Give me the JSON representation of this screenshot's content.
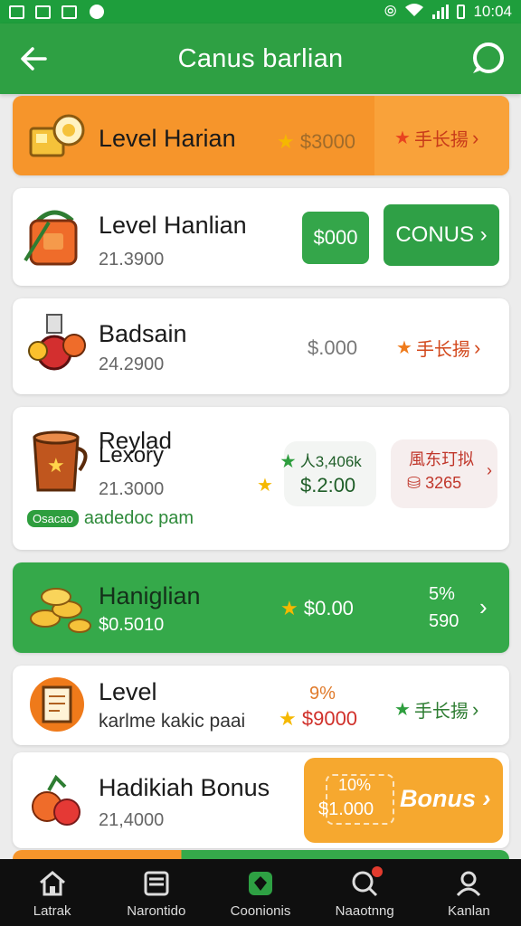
{
  "status": {
    "time": "10:04"
  },
  "header": {
    "title": "Canus barlian"
  },
  "cards": [
    {
      "name": "Level Harian",
      "price": "$3000",
      "action": "手长揚"
    },
    {
      "name": "Level Hanlian",
      "sub": "21.3900",
      "pill": "$000",
      "button": "CONUS"
    },
    {
      "name": "Badsain",
      "sub": "24.2900",
      "price": "$.000",
      "action": "手长揚"
    },
    {
      "name": "Reylad",
      "name2": "Lexory",
      "sub": "21.3000",
      "tag": "Osacao",
      "tag_text": "aadedoc pam",
      "price_top": "人3,406k",
      "price": "$.2:00",
      "action_top": "風东玎拟",
      "action": "3265"
    },
    {
      "name": "Haniglian",
      "sub": "$0.5010",
      "price": "$0.00",
      "percent": "5%",
      "percent_value": "590"
    },
    {
      "name": "Level",
      "sub": "karlme kakic paai",
      "percent": "9%",
      "price": "$9000",
      "action": "手长揚"
    },
    {
      "name": "Hadikiah Bonus",
      "sub": "21,4000",
      "percent": "10%",
      "price": "$1.000",
      "button": "Bonus"
    }
  ],
  "nav": [
    {
      "label": "Latrak"
    },
    {
      "label": "Narontido"
    },
    {
      "label": "Coonionis"
    },
    {
      "label": "Naaotnng"
    },
    {
      "label": "Kanlan"
    }
  ]
}
